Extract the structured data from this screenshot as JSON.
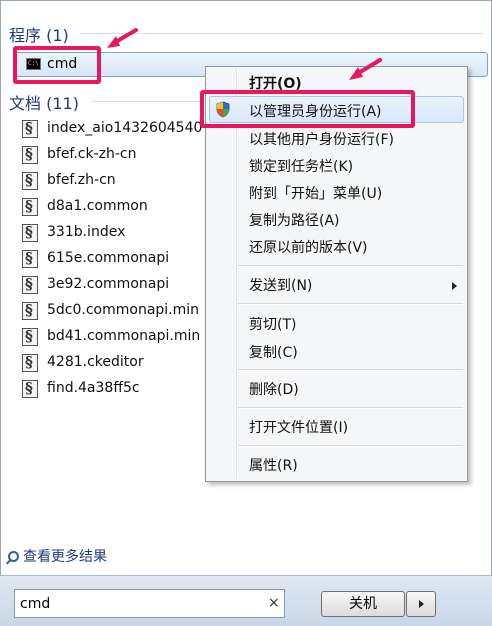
{
  "programs": {
    "heading": "程序 (1)",
    "item": {
      "label": "cmd",
      "icon": "cmd-icon"
    }
  },
  "documents": {
    "heading": "文档 (11)",
    "items": [
      "index_aio1432604540",
      "bfef.ck-zh-cn",
      "bfef.zh-cn",
      "d8a1.common",
      "331b.index",
      "615e.commonapi",
      "3e92.commonapi",
      "5dc0.commonapi.min",
      "bd41.commonapi.min",
      "4281.ckeditor",
      "find.4a38ff5c"
    ]
  },
  "context_menu": {
    "open": "打开(O)",
    "run_as_admin": "以管理员身份运行(A)",
    "run_as_other": "以其他用户身份运行(F)",
    "pin_taskbar": "锁定到任务栏(K)",
    "pin_start": "附到「开始」菜单(U)",
    "copy_path": "复制为路径(A)",
    "restore_versions": "还原以前的版本(V)",
    "send_to": "发送到(N)",
    "cut": "剪切(T)",
    "copy": "复制(C)",
    "delete": "删除(D)",
    "open_location": "打开文件位置(I)",
    "properties": "属性(R)"
  },
  "more_results": "查看更多结果",
  "search": {
    "value": "cmd",
    "clear": "×"
  },
  "shutdown": {
    "label": "关机"
  },
  "colors": {
    "highlight": "#e8175f",
    "heading": "#1e3a8a"
  }
}
